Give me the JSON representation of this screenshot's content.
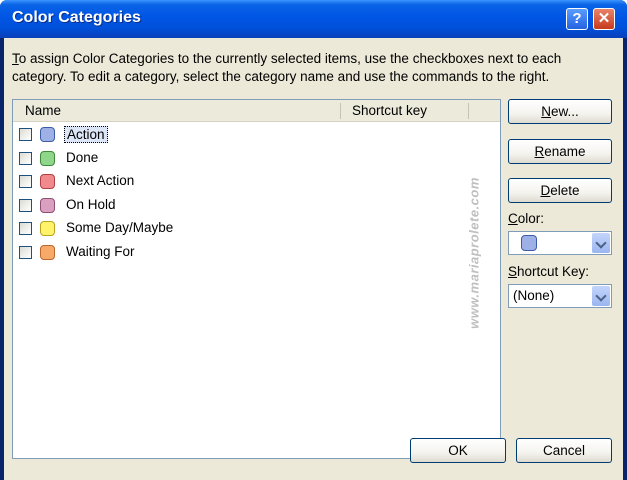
{
  "window": {
    "title": "Color Categories",
    "help_glyph": "?",
    "close_glyph": "✕"
  },
  "instructions": "To assign Color Categories to the currently selected items, use the checkboxes next to each category.  To edit a category, select the category name and use the commands to the right.",
  "list": {
    "columns": [
      "Name",
      "Shortcut key"
    ],
    "items": [
      {
        "name": "Action",
        "color": "#9db1e6",
        "border": "#3d5ca8",
        "checked": false,
        "selected": true
      },
      {
        "name": "Done",
        "color": "#8fd68b",
        "border": "#3f8a3a",
        "checked": false,
        "selected": false
      },
      {
        "name": "Next Action",
        "color": "#f08a8c",
        "border": "#b04044",
        "checked": false,
        "selected": false
      },
      {
        "name": "On Hold",
        "color": "#d9a0c0",
        "border": "#8f4f74",
        "checked": false,
        "selected": false
      },
      {
        "name": "Some Day/Maybe",
        "color": "#fff36b",
        "border": "#b8a420",
        "checked": false,
        "selected": false
      },
      {
        "name": "Waiting For",
        "color": "#f6aa6a",
        "border": "#c0652a",
        "checked": false,
        "selected": false
      }
    ]
  },
  "buttons": {
    "new": "New...",
    "rename": "Rename",
    "delete": "Delete",
    "ok": "OK",
    "cancel": "Cancel"
  },
  "color_label": "Color:",
  "color_value": {
    "color": "#9db1e6",
    "border": "#3d5ca8"
  },
  "shortcut_label": "Shortcut Key:",
  "shortcut_value": "(None)",
  "watermark": "www.mariaprolete.com"
}
